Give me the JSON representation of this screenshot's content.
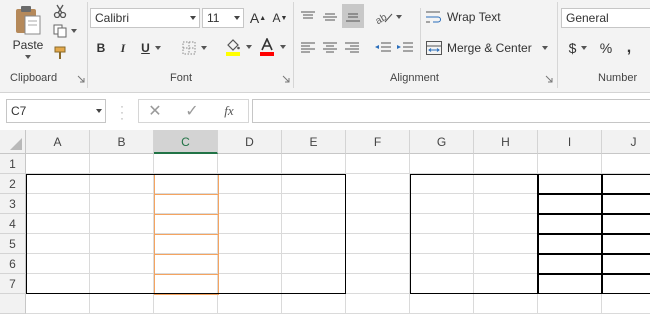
{
  "clipboard": {
    "paste_label": "Paste",
    "group_label": "Clipboard"
  },
  "font": {
    "name": "Calibri",
    "size": "11",
    "group_label": "Font",
    "bold": "B",
    "italic": "I",
    "underline": "U",
    "grow": "A",
    "shrink": "A"
  },
  "alignment": {
    "wrap_text": "Wrap Text",
    "merge_center": "Merge & Center",
    "group_label": "Alignment"
  },
  "number": {
    "format": "General",
    "currency": "$",
    "percent": "%",
    "comma": ",",
    "group_label": "Number"
  },
  "formula_bar": {
    "name_box": "C7",
    "fx": "fx",
    "value": ""
  },
  "columns": [
    "A",
    "B",
    "C",
    "D",
    "E",
    "F",
    "G",
    "H",
    "I",
    "J"
  ],
  "rows": [
    "1",
    "2",
    "3",
    "4",
    "5",
    "6",
    "7"
  ],
  "colors": {
    "accent": "#217346",
    "highlight": "#FFFF00",
    "font_color": "#FF0000",
    "selection_border": "#F4A460"
  }
}
